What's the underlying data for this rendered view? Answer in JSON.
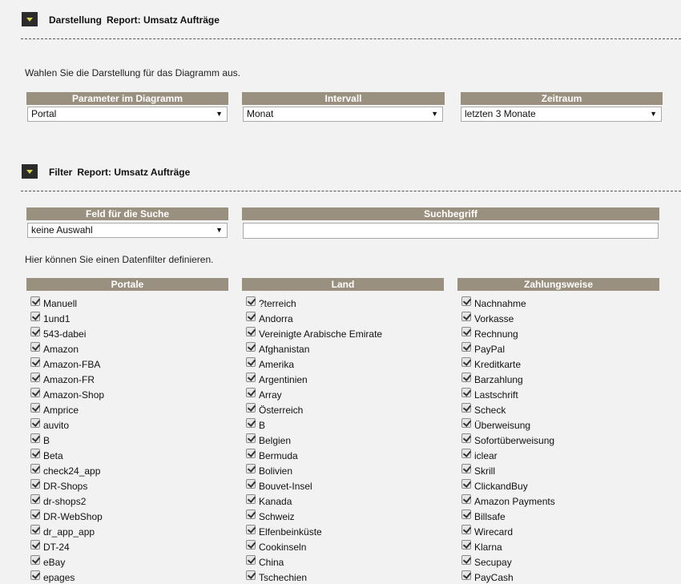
{
  "darstellung": {
    "title": "Darstellung",
    "subtitle": "Report: Umsatz Aufträge",
    "description": "Wahlen Sie die Darstellung für das Diagramm aus.",
    "parameter": {
      "header": "Parameter im Diagramm",
      "value": "Portal"
    },
    "intervall": {
      "header": "Intervall",
      "value": "Monat"
    },
    "zeitraum": {
      "header": "Zeitraum",
      "value": "letzten 3 Monate"
    }
  },
  "filter": {
    "title": "Filter",
    "subtitle": "Report: Umsatz Aufträge",
    "feld": {
      "header": "Feld für die Suche",
      "value": "keine Auswahl"
    },
    "suchbegriff": {
      "header": "Suchbegriff",
      "value": ""
    },
    "description": "Hier können Sie einen Datenfilter definieren.",
    "portale": {
      "header": "Portale",
      "items": [
        "Manuell",
        "1und1",
        "543-dabei",
        "Amazon",
        "Amazon-FBA",
        "Amazon-FR",
        "Amazon-Shop",
        "Amprice",
        "auvito",
        "B",
        "Beta",
        "check24_app",
        "DR-Shops",
        "dr-shops2",
        "DR-WebShop",
        "dr_app_app",
        "DT-24",
        "eBay",
        "epages"
      ]
    },
    "land": {
      "header": "Land",
      "items": [
        "?terreich",
        "Andorra",
        "Vereinigte Arabische Emirate",
        "Afghanistan",
        "Amerika",
        "Argentinien",
        "Array",
        "Österreich",
        "B",
        "Belgien",
        "Bermuda",
        "Bolivien",
        "Bouvet-Insel",
        "Kanada",
        "Schweiz",
        "Elfenbeinküste",
        "Cookinseln",
        "China",
        "Tschechien"
      ]
    },
    "zahlungsweise": {
      "header": "Zahlungsweise",
      "items": [
        "Nachnahme",
        "Vorkasse",
        "Rechnung",
        "PayPal",
        "Kreditkarte",
        "Barzahlung",
        "Lastschrift",
        "Scheck",
        "Überweisung",
        "Sofortüberweisung",
        "iclear",
        "Skrill",
        "ClickandBuy",
        "Amazon Payments",
        "Billsafe",
        "Wirecard",
        "Klarna",
        "Secupay",
        "PayCash"
      ]
    }
  }
}
